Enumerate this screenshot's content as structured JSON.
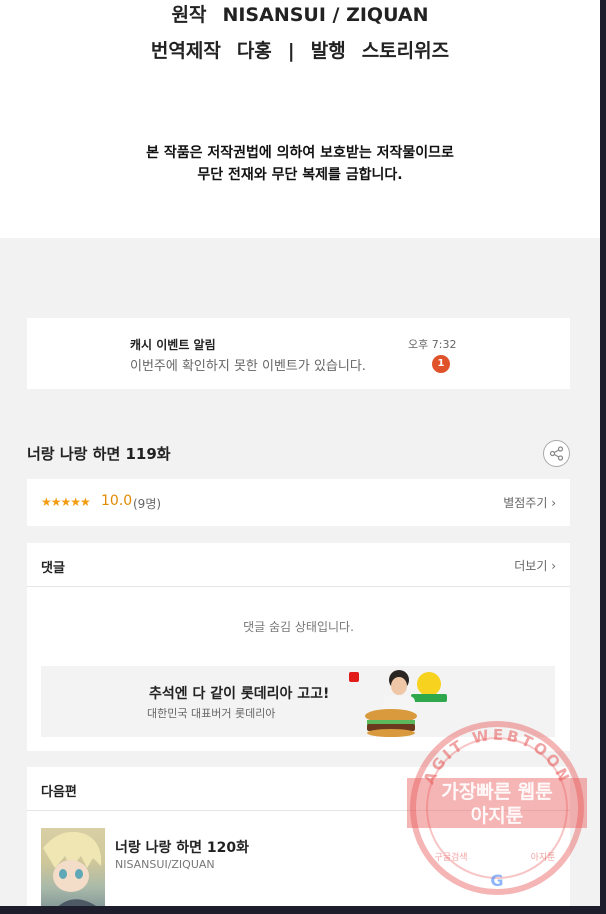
{
  "credits": {
    "original_label": "원작",
    "original_author": "NISANSUI / ZIQUAN",
    "translation_label": "번역제작",
    "translator": "다홍",
    "divider": "|",
    "publisher_label": "발행",
    "publisher": "스토리위즈"
  },
  "copyright": {
    "line1": "본 작품은 저작권법에 의하여 보호받는 저작물이므로",
    "line2": "무단 전재와 무단 복제를 금합니다."
  },
  "notice": {
    "title": "캐시 이벤트 알림",
    "message": "이번주에 확인하지 못한 이벤트가 있습니다.",
    "time": "오후 7:32",
    "badge_count": "1"
  },
  "episode": {
    "title": "너랑 나랑 하면 119화",
    "share_icon": "share-icon"
  },
  "rating": {
    "stars": "★★★★★",
    "score": "10.0",
    "count": "(9명)",
    "rate_label": "별점주기 ›"
  },
  "comments": {
    "label": "댓글",
    "more_label": "더보기 ›",
    "hidden_text": "댓글 숨김 상태입니다."
  },
  "ad": {
    "headline": "추석엔 다 같이 롯데리아 고고!",
    "sub": "대한민국 대표버거 롯데리아"
  },
  "next": {
    "label": "다음편",
    "title": "너랑 나랑 하면 120화",
    "author": "NISANSUI/ZIQUAN"
  },
  "watermark": {
    "ring_text": "AGIT WEBTOON",
    "line1": "가장빠른 웹툰",
    "line2": "아지툰",
    "bottom_left": "구글검색",
    "bottom_right": "아지툰"
  },
  "colors": {
    "badge": "#e0522a",
    "star": "#f39c12",
    "stamp": "#e85a5a"
  }
}
